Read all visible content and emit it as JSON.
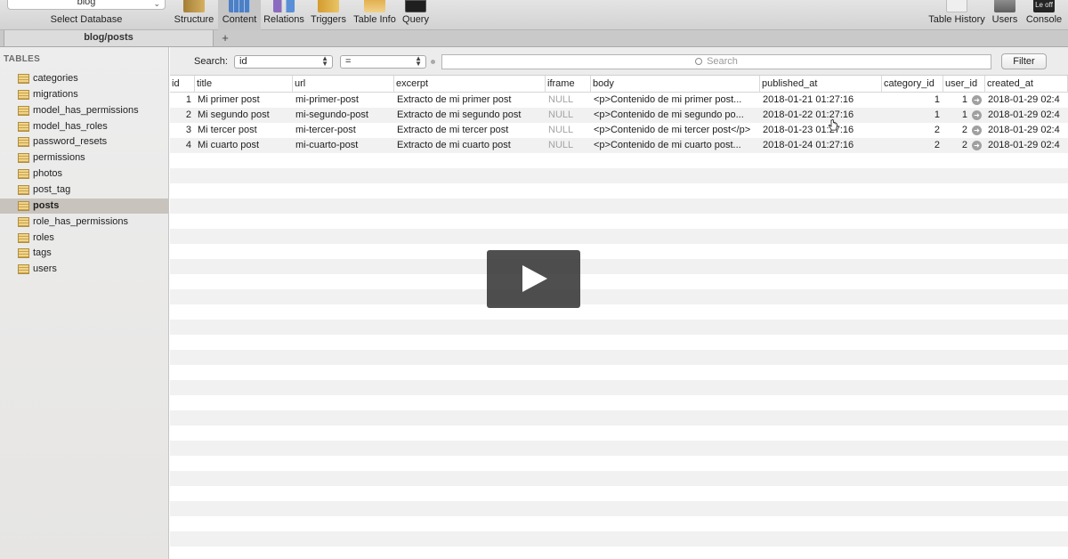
{
  "toolbar": {
    "database": "blog",
    "select_database_label": "Select Database",
    "buttons": {
      "structure": "Structure",
      "content": "Content",
      "relations": "Relations",
      "triggers": "Triggers",
      "table_info": "Table Info",
      "query": "Query",
      "table_history": "Table History",
      "users": "Users",
      "console": "Console"
    },
    "console_icon_text": "Le off"
  },
  "tab": {
    "title": "blog/posts",
    "add": "+"
  },
  "sidebar": {
    "header": "TABLES",
    "selected": "posts",
    "items": [
      "categories",
      "migrations",
      "model_has_permissions",
      "model_has_roles",
      "password_resets",
      "permissions",
      "photos",
      "post_tag",
      "posts",
      "role_has_permissions",
      "roles",
      "tags",
      "users"
    ]
  },
  "search": {
    "label": "Search:",
    "field": "id",
    "operator": "=",
    "placeholder": "Search",
    "filter_button": "Filter"
  },
  "grid": {
    "columns": [
      "id",
      "title",
      "url",
      "excerpt",
      "iframe",
      "body",
      "published_at",
      "category_id",
      "user_id",
      "created_at"
    ],
    "rows": [
      {
        "id": "1",
        "title": "Mi primer post",
        "url": "mi-primer-post",
        "excerpt": "Extracto de mi primer post",
        "iframe": "NULL",
        "body": "<p>Contenido de mi primer post...",
        "published_at": "2018-01-21 01:27:16",
        "category_id": "1",
        "user_id": "1",
        "created_at": "2018-01-29 02:4"
      },
      {
        "id": "2",
        "title": "Mi segundo post",
        "url": "mi-segundo-post",
        "excerpt": "Extracto de mi segundo post",
        "iframe": "NULL",
        "body": "<p>Contenido de mi segundo po...",
        "published_at": "2018-01-22 01:27:16",
        "category_id": "1",
        "user_id": "1",
        "created_at": "2018-01-29 02:4"
      },
      {
        "id": "3",
        "title": "Mi tercer post",
        "url": "mi-tercer-post",
        "excerpt": "Extracto de mi tercer post",
        "iframe": "NULL",
        "body": "<p>Contenido de mi tercer post</p>",
        "published_at": "2018-01-23 01:27:16",
        "category_id": "2",
        "user_id": "2",
        "created_at": "2018-01-29 02:4"
      },
      {
        "id": "4",
        "title": "Mi cuarto post",
        "url": "mi-cuarto-post",
        "excerpt": "Extracto de mi cuarto post",
        "iframe": "NULL",
        "body": "<p>Contenido de mi cuarto post...",
        "published_at": "2018-01-24 01:27:16",
        "category_id": "2",
        "user_id": "2",
        "created_at": "2018-01-29 02:4"
      }
    ]
  },
  "colors": {
    "toolbar_bg": "#d8d8d8",
    "sidebar_selected": "#c8c3bc",
    "null_text": "#a4a4a4",
    "row_stripe": "#f1f1f1"
  }
}
